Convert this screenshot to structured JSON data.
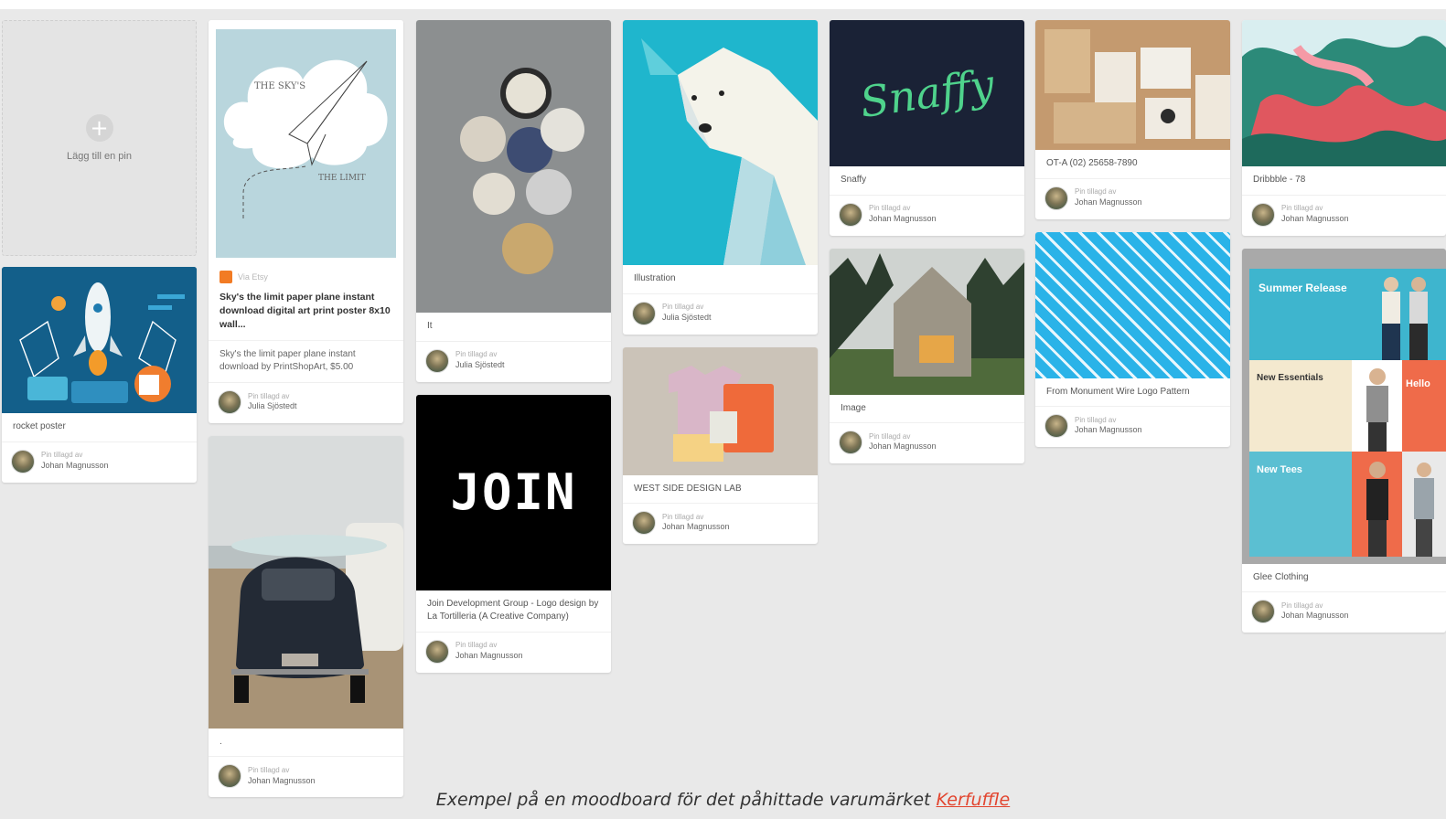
{
  "caption": {
    "text": "Exempel på en moodboard för det påhittade varumärket",
    "link": "Kerfuffle"
  },
  "add_pin": {
    "label": "Lägg till en pin"
  },
  "pins": {
    "rocket": {
      "caption": "rocket poster",
      "meta1": "Pin tillagd av",
      "meta2": "Johan Magnusson"
    },
    "plane": {
      "source": "Via Etsy",
      "caption": "Sky's the limit paper plane instant download digital art print poster 8x10 wall...",
      "desc": "Sky's the limit paper plane instant download by PrintShopArt, $5.00",
      "meta1": "Pin tillagd av",
      "meta2": "Julia Sjöstedt"
    },
    "car": {
      "caption": ".",
      "meta1": "Pin tillagd av",
      "meta2": "Johan Magnusson"
    },
    "plates": {
      "caption": "It",
      "meta1": "Pin tillagd av",
      "meta2": "Julia Sjöstedt"
    },
    "join": {
      "caption": "Join Development Group - Logo design by La Tortilleria (A Creative Company)",
      "logo": "JOIN",
      "meta1": "Pin tillagd av",
      "meta2": "Johan Magnusson"
    },
    "bear": {
      "caption": "Illustration",
      "meta1": "Pin tillagd av",
      "meta2": "Julia Sjöstedt"
    },
    "tshirt": {
      "caption": "WEST SIDE DESIGN LAB",
      "meta1": "Pin tillagd av",
      "meta2": "Johan Magnusson"
    },
    "snaffy": {
      "caption": "Snaffy",
      "logo": "Snaffy",
      "meta1": "Pin tillagd av",
      "meta2": "Johan Magnusson"
    },
    "house": {
      "caption": "Image",
      "meta1": "Pin tillagd av",
      "meta2": "Johan Magnusson"
    },
    "stationery": {
      "caption": "OT-A (02) 25658-7890",
      "meta1": "Pin tillagd av",
      "meta2": "Johan Magnusson"
    },
    "pattern": {
      "caption": "From Monument Wire Logo Pattern",
      "meta1": "Pin tillagd av",
      "meta2": "Johan Magnusson"
    },
    "paint": {
      "caption": "Dribbble - 78",
      "meta1": "Pin tillagd av",
      "meta2": "Johan Magnusson"
    },
    "clothing": {
      "caption": "Glee Clothing",
      "banner1": "Summer Release",
      "banner2": "New Essentials",
      "banner3": "Hello",
      "banner4": "New Tees",
      "meta1": "Pin tillagd av",
      "meta2": "Johan Magnusson"
    }
  }
}
